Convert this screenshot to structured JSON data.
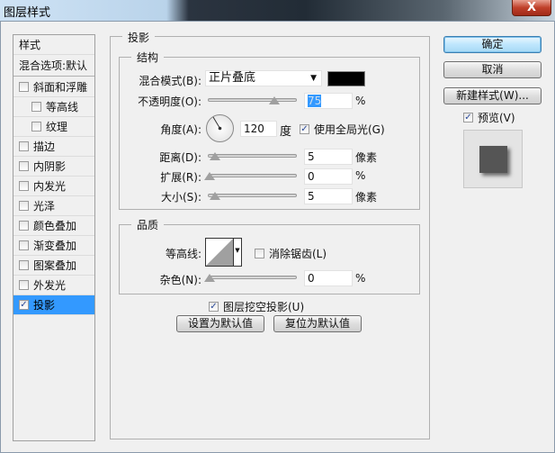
{
  "window": {
    "title": "图层样式",
    "close_label": "X"
  },
  "sidebar": {
    "header": "样式",
    "blend_options": "混合选项:默认",
    "items": [
      {
        "label": "斜面和浮雕",
        "checked": false
      },
      {
        "label": "等高线",
        "checked": false
      },
      {
        "label": "纹理",
        "checked": false
      },
      {
        "label": "描边",
        "checked": false
      },
      {
        "label": "内阴影",
        "checked": false
      },
      {
        "label": "内发光",
        "checked": false
      },
      {
        "label": "光泽",
        "checked": false
      },
      {
        "label": "颜色叠加",
        "checked": false
      },
      {
        "label": "渐变叠加",
        "checked": false
      },
      {
        "label": "图案叠加",
        "checked": false
      },
      {
        "label": "外发光",
        "checked": false
      },
      {
        "label": "投影",
        "checked": true
      }
    ]
  },
  "panel": {
    "title": "投影",
    "structure": {
      "title": "结构",
      "blend_mode_label": "混合模式(B):",
      "blend_mode_value": "正片叠底",
      "shadow_color": "#000000",
      "opacity_label": "不透明度(O):",
      "opacity_value": "75",
      "opacity_unit": "%",
      "angle_label": "角度(A):",
      "angle_value": "120",
      "angle_unit": "度",
      "global_light_label": "使用全局光(G)",
      "global_light_checked": true,
      "distance_label": "距离(D):",
      "distance_value": "5",
      "distance_unit": "像素",
      "spread_label": "扩展(R):",
      "spread_value": "0",
      "spread_unit": "%",
      "size_label": "大小(S):",
      "size_value": "5",
      "size_unit": "像素"
    },
    "quality": {
      "title": "品质",
      "contour_label": "等高线:",
      "antialias_label": "消除锯齿(L)",
      "antialias_checked": false,
      "noise_label": "杂色(N):",
      "noise_value": "0",
      "noise_unit": "%"
    },
    "knockout_label": "图层挖空投影(U)",
    "knockout_checked": true,
    "make_default": "设置为默认值",
    "reset_default": "复位为默认值"
  },
  "actions": {
    "ok": "确定",
    "cancel": "取消",
    "new_style": "新建样式(W)...",
    "preview_label": "预览(V)",
    "preview_checked": true
  }
}
